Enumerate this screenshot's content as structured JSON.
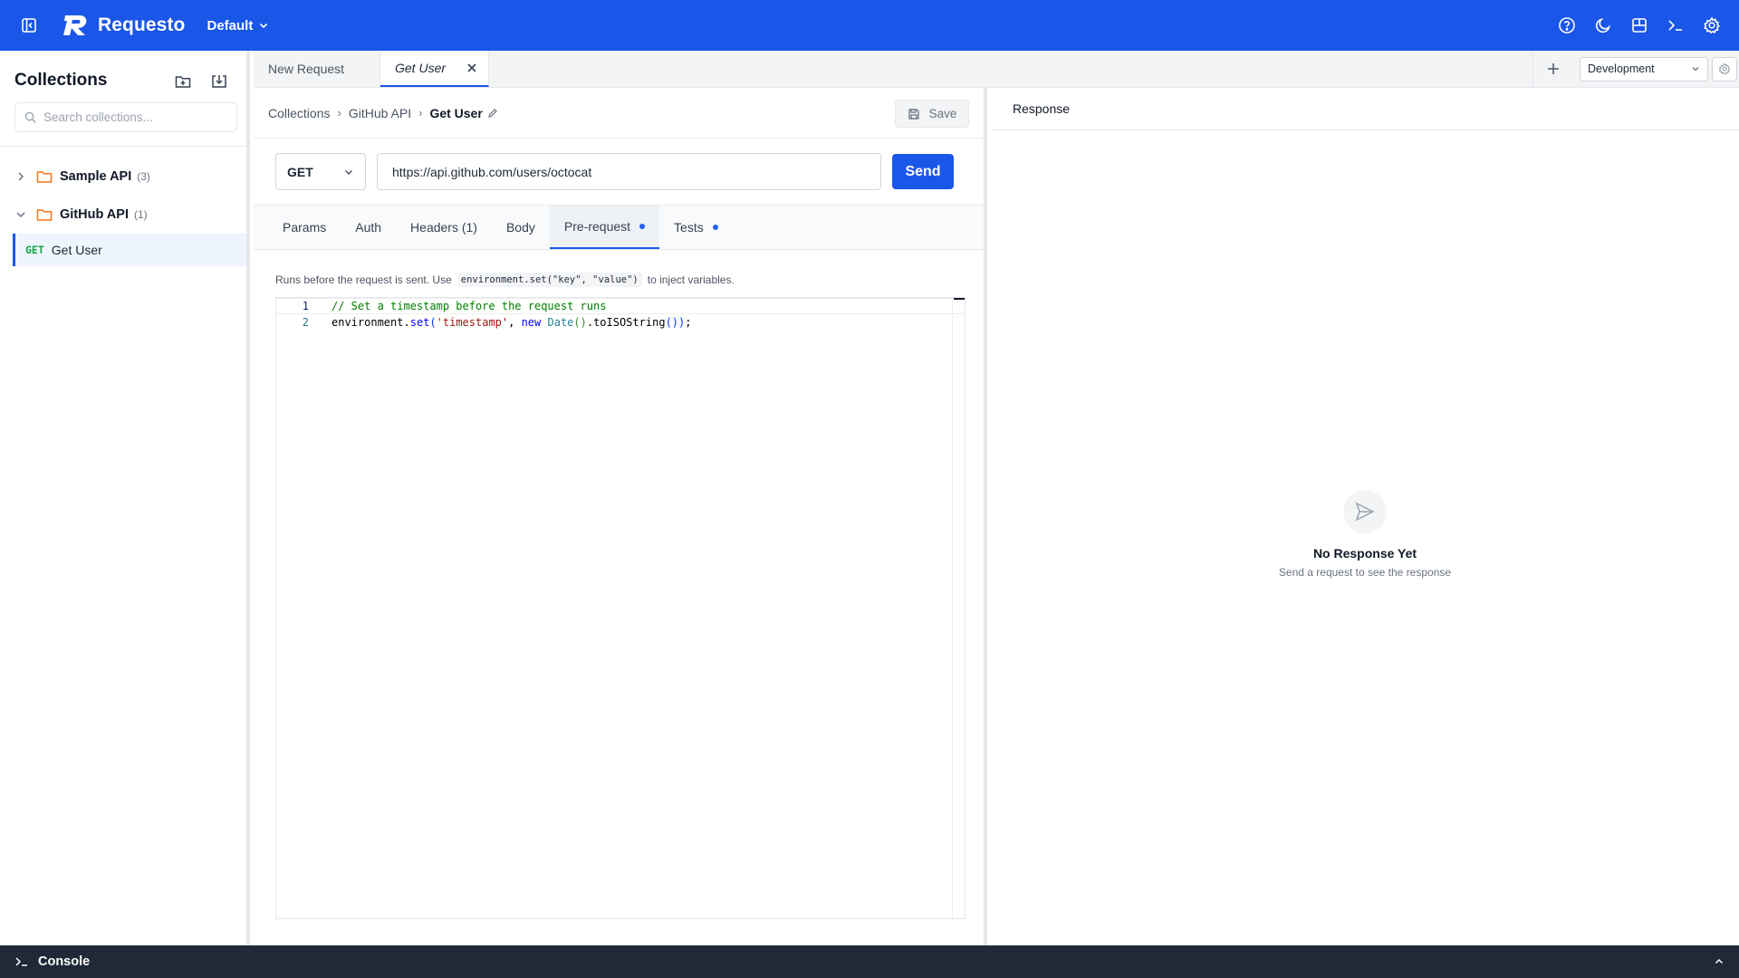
{
  "app": {
    "name": "Requesto",
    "workspace": "Default"
  },
  "colors": {
    "brand": "#1a56e8",
    "folder": "#f97316",
    "method_get": "#16a34a",
    "dot": "#2563eb"
  },
  "topbar": {
    "icons": [
      "sidebar-toggle-icon",
      "help-icon",
      "moon-icon",
      "layout-icon",
      "terminal-icon",
      "gear-icon"
    ]
  },
  "sidebar": {
    "title": "Collections",
    "search_placeholder": "Search collections...",
    "folders": [
      {
        "name": "Sample API",
        "count": "(3)",
        "expanded": false
      },
      {
        "name": "GitHub API",
        "count": "(1)",
        "expanded": true
      }
    ],
    "requests": [
      {
        "method": "GET",
        "name": "Get User"
      }
    ]
  },
  "tabs": [
    {
      "label": "New Request"
    },
    {
      "label": "Get User"
    }
  ],
  "environment": {
    "selected": "Development"
  },
  "request": {
    "breadcrumb": [
      "Collections",
      "GitHub API",
      "Get User"
    ],
    "save_label": "Save",
    "method": "GET",
    "url": "https://api.github.com/users/octocat",
    "send_label": "Send",
    "subtabs": [
      "Params",
      "Auth",
      "Headers (1)",
      "Body",
      "Pre-request",
      "Tests"
    ],
    "helper_prefix": "Runs before the request is sent. Use",
    "helper_code": "environment.set(\"key\", \"value\")",
    "helper_suffix": "to inject variables.",
    "code": {
      "line_numbers": [
        "1",
        "2"
      ],
      "line1": "// Set a timestamp before the request runs",
      "line2_obj": "environment",
      "line2_dot": ".",
      "line2_fn": "set",
      "line2_open": "(",
      "line2_str": "'timestamp'",
      "line2_comma": ", ",
      "line2_kw": "new",
      "line2_space": " ",
      "line2_cls": "Date",
      "line2_paren": "()",
      "line2_method": ".toISOString",
      "line2_close": "())",
      "line2_semi": ";"
    }
  },
  "response": {
    "title": "Response",
    "empty_title": "No Response Yet",
    "empty_sub": "Send a request to see the response"
  },
  "console": {
    "label": "Console"
  }
}
